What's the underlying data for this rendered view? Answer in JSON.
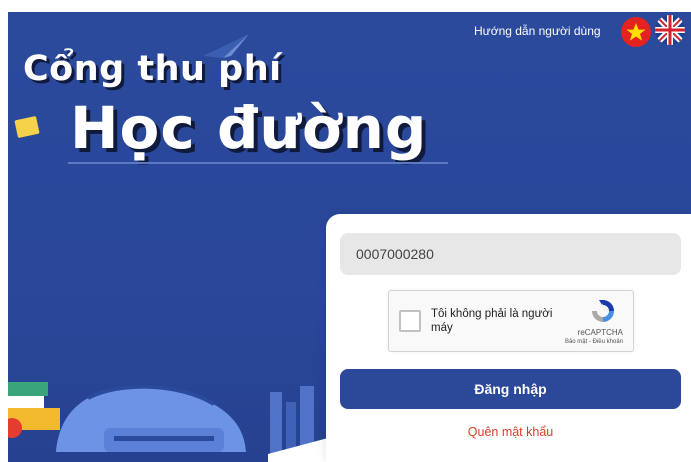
{
  "header": {
    "guide_link": "Hướng dẫn người dùng",
    "languages": [
      "vi",
      "en"
    ]
  },
  "hero": {
    "title_line1": "Cổng thu phí",
    "title_line2": "Học đường"
  },
  "login": {
    "id_value": "0007000280",
    "recaptcha": {
      "label": "Tôi không phải là người máy",
      "brand": "reCAPTCHA",
      "terms": "Bảo mật - Điều khoản",
      "checked": false
    },
    "login_button": "Đăng nhập",
    "forgot_password": "Quên mật khẩu"
  },
  "colors": {
    "background": "#2b4a9c",
    "primary_button": "#2c4898",
    "link_red": "#d6402b"
  },
  "icons": [
    "vietnam-flag-icon",
    "uk-flag-icon",
    "recaptcha-logo-icon",
    "paper-plane-icon",
    "ticket-icon"
  ]
}
